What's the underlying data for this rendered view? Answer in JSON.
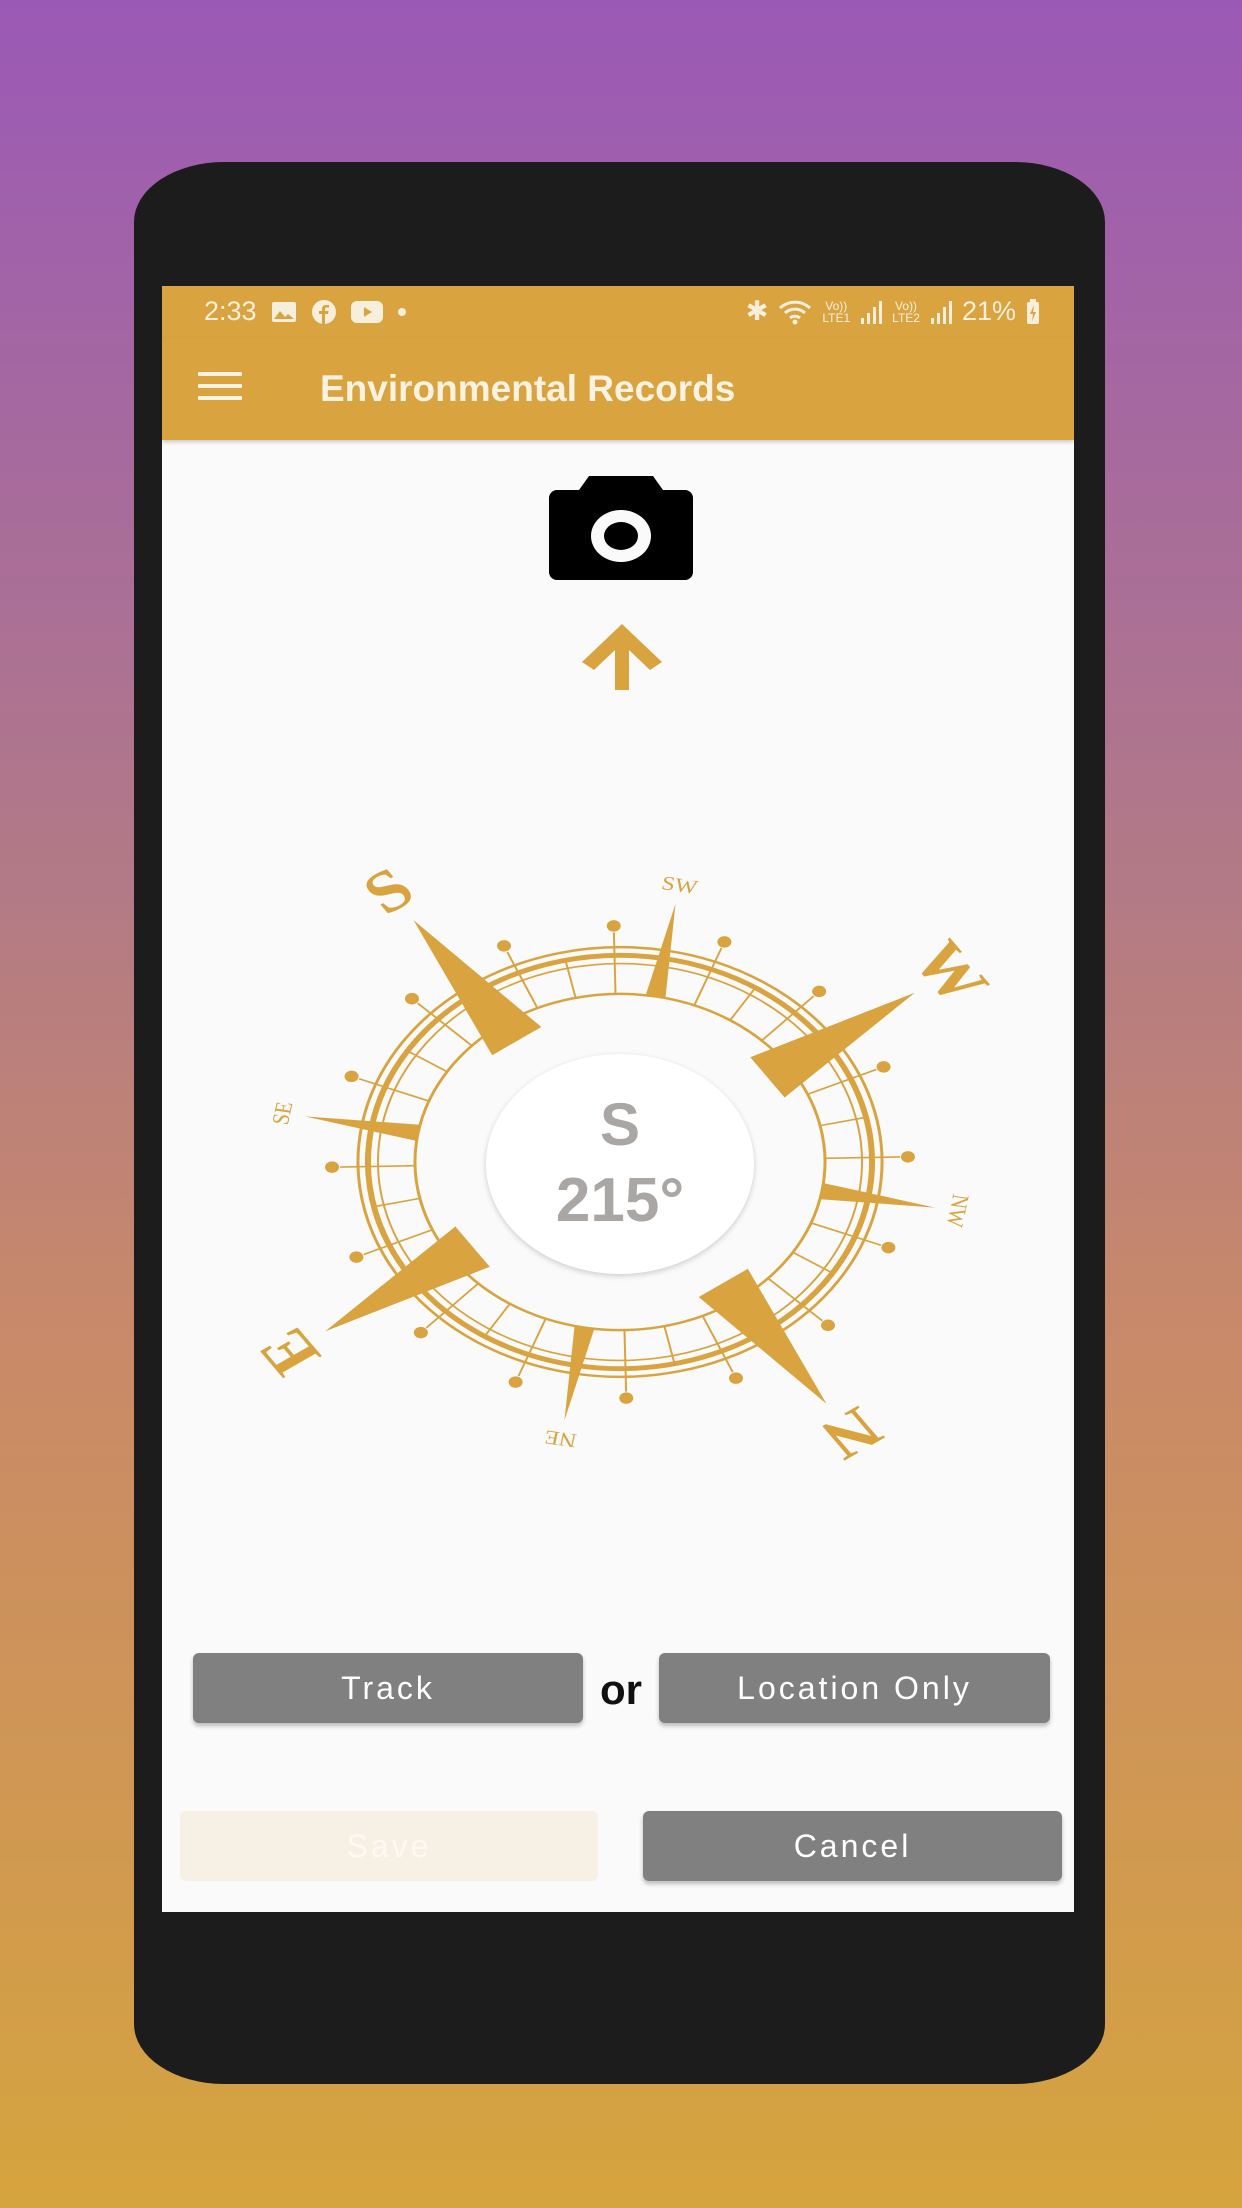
{
  "status_bar": {
    "time": "2:33",
    "battery": "21%",
    "sim1": "LTE1",
    "sim2": "LTE2",
    "volte": "Vo))",
    "icons": [
      "gallery-icon",
      "facebook-icon",
      "youtube-icon",
      "dot-icon",
      "bluetooth-icon",
      "wifi-icon",
      "signal-icon",
      "signal-icon",
      "battery-charging-icon"
    ]
  },
  "app_bar": {
    "title": "Environmental Records",
    "menu_icon": "hamburger-icon"
  },
  "colors": {
    "accent": "#d9a440",
    "button": "#808080",
    "background": "#fafafa",
    "readout_text": "#aaa6a4"
  },
  "compass": {
    "heading_direction": "S",
    "heading_degrees": "215°",
    "heading_value": 215,
    "cardinals": [
      "N",
      "E",
      "S",
      "W"
    ],
    "intercardinals": [
      "NE",
      "SE",
      "SW",
      "NW"
    ]
  },
  "actions": {
    "track": "Track",
    "or": "or",
    "location_only": "Location Only",
    "save": "Save",
    "cancel": "Cancel"
  }
}
